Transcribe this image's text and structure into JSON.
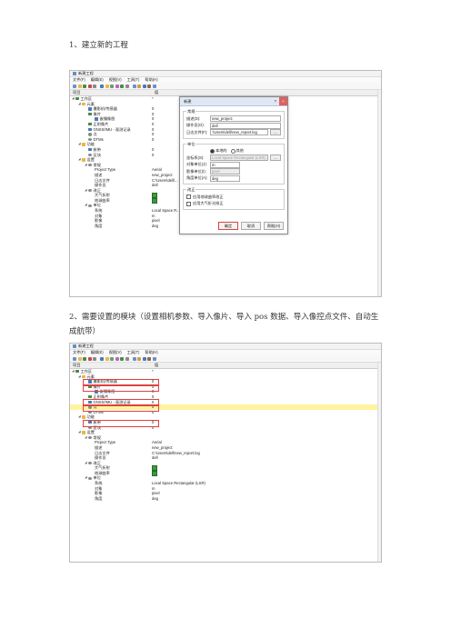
{
  "steps": {
    "step1": "1、建立新的工程",
    "step2_line1": "2、需要设置的模块（设置相机参数、导入像片、导入 pos 数据、导入像控点文件、自动生",
    "step2_line2": "成航带）"
  },
  "app": {
    "title": "新建工程",
    "menu": [
      "文件(F)",
      "编辑(E)",
      "视图(V)",
      "工具(T)",
      "帮助(H)"
    ],
    "col_item": "项目",
    "col_value": "值"
  },
  "tree1": [
    {
      "label": "工作区",
      "value": "*",
      "indent": 0,
      "icon": "node"
    },
    {
      "label": "元素",
      "value": "",
      "indent": 1,
      "icon": "folder"
    },
    {
      "label": "摄影机/传感器",
      "value": "0",
      "indent": 2,
      "icon": "cam"
    },
    {
      "label": "像片",
      "value": "0",
      "indent": 2,
      "icon": "node"
    },
    {
      "label": "嵌镶像图",
      "value": "0",
      "indent": 3,
      "icon": "cam"
    },
    {
      "label": "正射像片",
      "value": "0",
      "indent": 2,
      "icon": "node"
    },
    {
      "label": "GNSS/IMU - 观测记录",
      "value": "0",
      "indent": 2,
      "icon": "cam"
    },
    {
      "label": "点",
      "value": "0",
      "indent": 2,
      "icon": "gear"
    },
    {
      "label": "DTMs",
      "value": "0",
      "indent": 2,
      "icon": "gear"
    },
    {
      "label": "功能",
      "value": "",
      "indent": 1,
      "icon": "folder"
    },
    {
      "label": "航带",
      "value": "0",
      "indent": 2,
      "icon": "cam"
    },
    {
      "label": "区块",
      "value": "0",
      "indent": 2,
      "icon": "gear"
    },
    {
      "label": "设置",
      "value": "",
      "indent": 1,
      "icon": "folder"
    },
    {
      "label": "常规",
      "value": "",
      "indent": 2,
      "icon": "gear"
    },
    {
      "label": "Project Type",
      "value": "Aerial",
      "indent": 3,
      "icon": ""
    },
    {
      "label": "描述",
      "value": "new_project",
      "indent": 3,
      "icon": ""
    },
    {
      "label": "日志文件",
      "value": "C:\\Users\\dell\\...",
      "indent": 3,
      "icon": ""
    },
    {
      "label": "操作员",
      "value": "dell",
      "indent": 3,
      "icon": ""
    },
    {
      "label": "改正",
      "value": "",
      "indent": 2,
      "icon": "gear"
    },
    {
      "label": "大气折射",
      "value": "check",
      "indent": 3,
      "icon": ""
    },
    {
      "label": "地球曲率",
      "value": "check",
      "indent": 3,
      "icon": ""
    },
    {
      "label": "单位",
      "value": "",
      "indent": 2,
      "icon": "gear"
    },
    {
      "label": "系统",
      "value": "Local Space R...",
      "indent": 3,
      "icon": ""
    },
    {
      "label": "对象",
      "value": "m",
      "indent": 3,
      "icon": ""
    },
    {
      "label": "影像",
      "value": "pixel",
      "indent": 3,
      "icon": ""
    },
    {
      "label": "角度",
      "value": "deg",
      "indent": 3,
      "icon": ""
    }
  ],
  "tree2": [
    {
      "label": "工作区",
      "value": "*",
      "indent": 0,
      "icon": "node"
    },
    {
      "label": "元素",
      "value": "",
      "indent": 1,
      "icon": "folder"
    },
    {
      "label": "摄影机/传感器",
      "value": "0",
      "indent": 2,
      "icon": "cam"
    },
    {
      "label": "像片",
      "value": "0",
      "indent": 2,
      "icon": "node"
    },
    {
      "label": "嵌镶像图",
      "value": "0",
      "indent": 3,
      "icon": "cam"
    },
    {
      "label": "正射像片",
      "value": "0",
      "indent": 2,
      "icon": "node"
    },
    {
      "label": "GNSS/IMU - 观测记录",
      "value": "0",
      "indent": 2,
      "icon": "cam"
    },
    {
      "label": "点",
      "value": "0",
      "indent": 2,
      "icon": "gear"
    },
    {
      "label": "DTMs",
      "value": "0",
      "indent": 2,
      "icon": "gear"
    },
    {
      "label": "功能",
      "value": "",
      "indent": 1,
      "icon": "folder"
    },
    {
      "label": "航带",
      "value": "0",
      "indent": 2,
      "icon": "cam"
    },
    {
      "label": "区块",
      "value": "0",
      "indent": 2,
      "icon": "gear"
    },
    {
      "label": "设置",
      "value": "",
      "indent": 1,
      "icon": "folder"
    },
    {
      "label": "常规",
      "value": "",
      "indent": 2,
      "icon": "gear"
    },
    {
      "label": "Project Type",
      "value": "Aerial",
      "indent": 3,
      "icon": ""
    },
    {
      "label": "描述",
      "value": "new_project",
      "indent": 3,
      "icon": ""
    },
    {
      "label": "日志文件",
      "value": "C:\\Users\\dell\\new_report.log",
      "indent": 3,
      "icon": ""
    },
    {
      "label": "操作员",
      "value": "dell",
      "indent": 3,
      "icon": ""
    },
    {
      "label": "改正",
      "value": "",
      "indent": 2,
      "icon": "gear"
    },
    {
      "label": "大气折射",
      "value": "check",
      "indent": 3,
      "icon": ""
    },
    {
      "label": "地球曲率",
      "value": "check",
      "indent": 3,
      "icon": ""
    },
    {
      "label": "单位",
      "value": "",
      "indent": 2,
      "icon": "gear"
    },
    {
      "label": "系统",
      "value": "Local Space Rectangular (LSR)",
      "indent": 3,
      "icon": ""
    },
    {
      "label": "对象",
      "value": "m",
      "indent": 3,
      "icon": ""
    },
    {
      "label": "影像",
      "value": "pixel",
      "indent": 3,
      "icon": ""
    },
    {
      "label": "角度",
      "value": "deg",
      "indent": 3,
      "icon": ""
    }
  ],
  "dialog": {
    "title": "新建",
    "help": "?",
    "close": "×",
    "sec_general": "常规",
    "name_label": "描述(D):",
    "name_value": "new_project",
    "operator_label": "操作员(O):",
    "operator_value": "dell",
    "log_label": "日志文件(F):",
    "log_value": ":\\Users\\dell\\new_report.log",
    "browse": "...",
    "sec_units": "单位",
    "coord_label": "坐标系(S):",
    "radio_local": "本地的",
    "radio_geo": "其他",
    "coord_value": "Local Space Rectangular (LSR)",
    "obj_unit_label": "对象单位(J):",
    "obj_unit_value": "m",
    "img_unit_label": "影像单位(I):",
    "img_unit_value": "pixel",
    "angle_unit_label": "角度单位(A):",
    "angle_unit_value": "deg",
    "sec_corr": "改正",
    "corr1": "应用地球曲率改正",
    "corr2": "应用大气折光修正",
    "ok": "确定",
    "cancel": "取消",
    "help_btn": "帮助(H)"
  },
  "colors": {
    "accent": "#e04040",
    "highlight": "#fff3a0"
  }
}
